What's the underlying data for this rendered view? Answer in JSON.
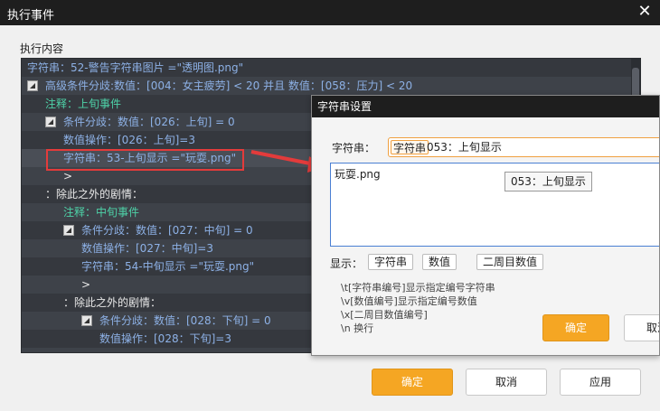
{
  "window": {
    "title": "执行事件",
    "close_glyph": "✕"
  },
  "main": {
    "section_label": "执行内容",
    "rows": [
      {
        "text": "字符串：52-警告字符串图片 =\"透明图.png\"",
        "color": "blue"
      },
      {
        "text": "高级条件分歧:数值：[004：女主疲劳] < 20 并且 数值：[058：压力] < 20",
        "color": "blue",
        "toggle": true
      },
      {
        "text": "注释：上旬事件",
        "color": "green"
      },
      {
        "text": "条件分歧：数值：[026：上旬] = 0",
        "color": "blue",
        "toggle": true
      },
      {
        "text": "数值操作：[026：上旬]=3",
        "color": "blue"
      },
      {
        "text": "字符串：53-上旬显示 =\"玩耍.png\"",
        "color": "blue"
      },
      {
        "text": ">",
        "color": "white"
      },
      {
        "text": "：除此之外的剧情：",
        "color": "white"
      },
      {
        "text": "注释：中旬事件",
        "color": "green"
      },
      {
        "text": "条件分歧：数值：[027：中旬] = 0",
        "color": "blue",
        "toggle": true
      },
      {
        "text": "数值操作：[027：中旬]=3",
        "color": "blue"
      },
      {
        "text": "字符串：54-中旬显示 =\"玩耍.png\"",
        "color": "blue"
      },
      {
        "text": ">",
        "color": "white"
      },
      {
        "text": "：除此之外的剧情：",
        "color": "white"
      },
      {
        "text": "条件分歧：数值：[028：下旬] = 0",
        "color": "blue",
        "toggle": true
      },
      {
        "text": "数值操作：[028：下旬]=3",
        "color": "blue"
      }
    ]
  },
  "footer": {
    "ok": "确定",
    "cancel": "取消",
    "apply": "应用"
  },
  "subdialog": {
    "title": "字符串设置",
    "string_label": "字符串：",
    "string_prefix": "字符串",
    "string_value": "053：上旬显示",
    "text_value": "玩耍.png",
    "tooltip": "053：上旬显示",
    "display_label": "显示：",
    "chips": [
      "字符串",
      "数值",
      "二周目数值"
    ],
    "help": [
      "\\t[字符串编号]显示指定编号字符串",
      "\\v[数值编号]显示指定编号数值",
      "\\x[二周目数值编号]",
      "\\n 换行"
    ],
    "ok": "确定",
    "cancel": "取消"
  },
  "colors": {
    "accent": "#f5a623",
    "list_bg": "#3e4249",
    "highlight": "#e33b3b",
    "text_blue": "#8db1e6",
    "text_green": "#4ed2a8"
  }
}
